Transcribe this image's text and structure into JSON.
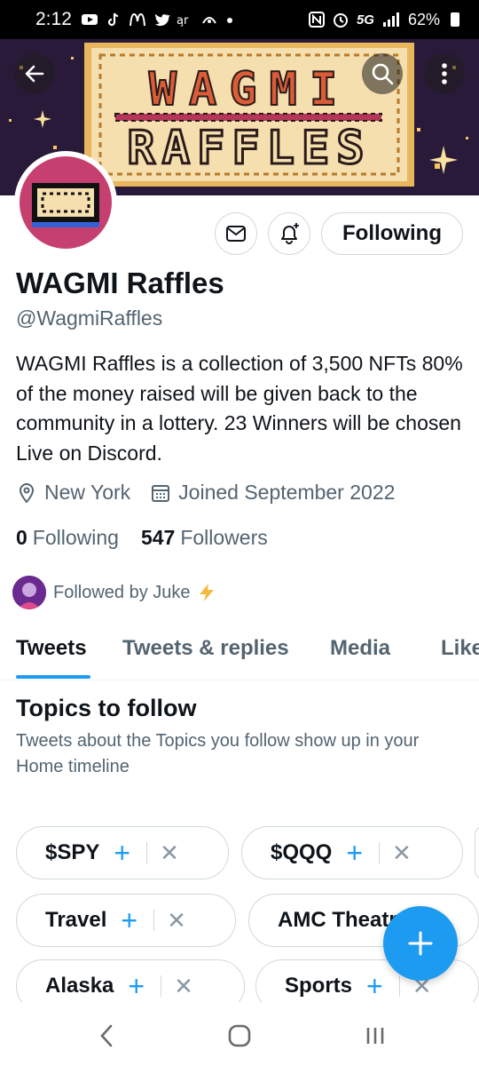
{
  "status_bar": {
    "time": "2:12",
    "network": "5G",
    "battery": "62%"
  },
  "banner": {
    "line1": "WAGMI",
    "line2": "RAFFLES"
  },
  "profile": {
    "name": "WAGMI Raffles",
    "handle": "@WagmiRaffles",
    "bio": "WAGMI Raffles is a collection of 3,500 NFTs 80% of the money raised will be given back to the community in a lottery. 23 Winners will be chosen Live on Discord.",
    "location": "New York",
    "joined": "Joined September 2022",
    "following_count": "0",
    "following_label": "Following",
    "followers_count": "547",
    "followers_label": "Followers",
    "followed_by": "Followed by Juke",
    "follow_button": "Following"
  },
  "tabs": [
    {
      "label": "Tweets"
    },
    {
      "label": "Tweets & replies"
    },
    {
      "label": "Media"
    },
    {
      "label": "Likes"
    }
  ],
  "topics": {
    "title": "Topics to follow",
    "subtitle": "Tweets about the Topics you follow show up in your Home timeline",
    "chips": [
      {
        "label": "$SPY"
      },
      {
        "label": "$QQQ"
      },
      {
        "label": "Travel"
      },
      {
        "label": "AMC Theatres"
      },
      {
        "label": "Alaska"
      },
      {
        "label": "Sports"
      }
    ]
  },
  "colors": {
    "accent": "#1d9bf0",
    "avatar_bg": "#c6406f",
    "banner_bg": "#2a1a3a",
    "ticket": "#f6dfae"
  }
}
